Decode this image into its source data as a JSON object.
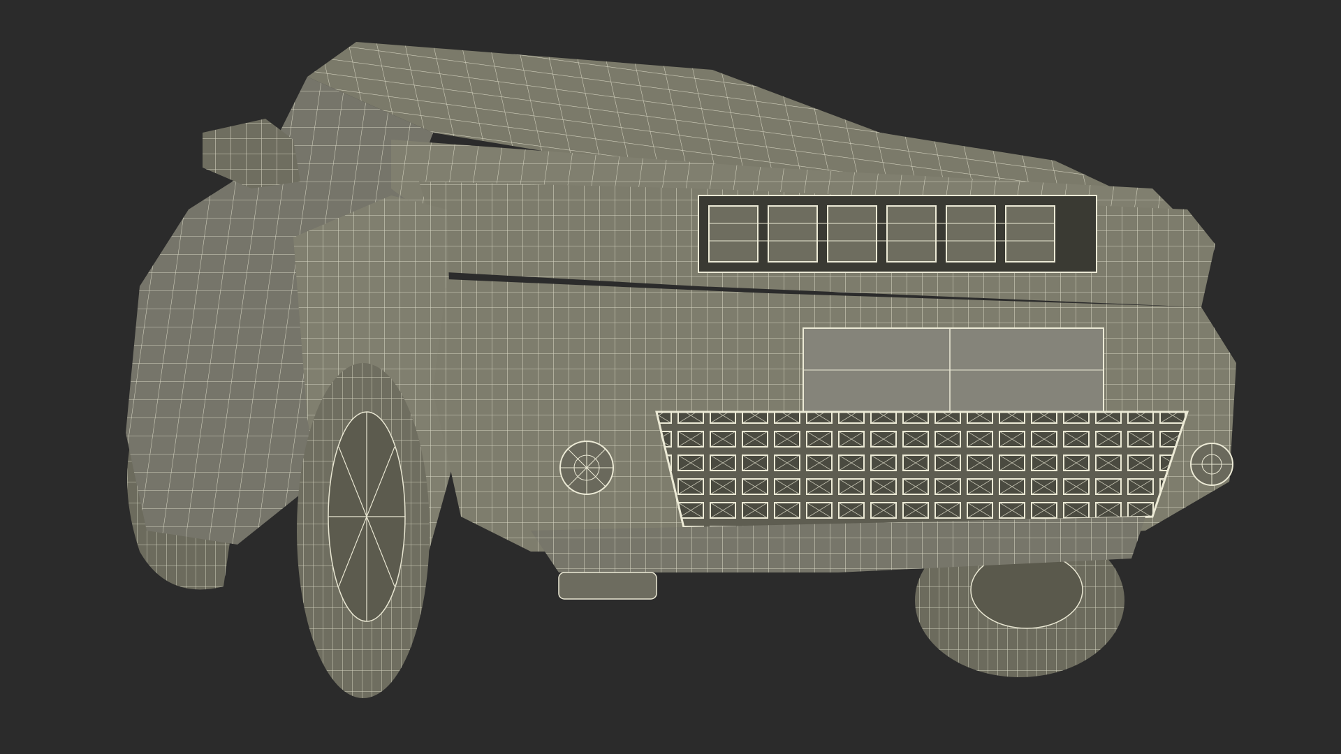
{
  "scene": {
    "background_color": "#2b2b2b",
    "body_color": "#7b7a6a",
    "body_shadow_color": "#5f5e51",
    "wire_color": "#e8e6d2",
    "subject": "suv-wireframe-render"
  }
}
